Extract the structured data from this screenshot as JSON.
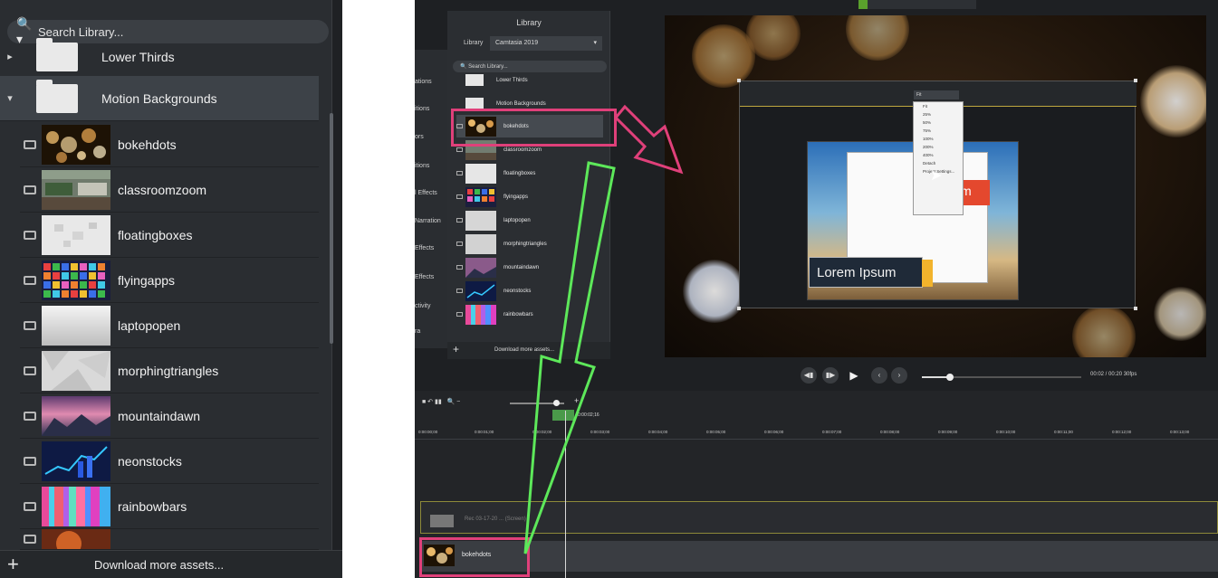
{
  "left_panel": {
    "search_placeholder": "Search Library...",
    "lower_thirds_label": "Lower Thirds",
    "motion_backgrounds_label": "Motion Backgrounds",
    "items": [
      "bokehdots",
      "classroomzoom",
      "floatingboxes",
      "flyingapps",
      "laptopopen",
      "morphingtriangles",
      "mountaindawn",
      "neonstocks",
      "rainbowbars"
    ],
    "download_label": "Download more assets..."
  },
  "app": {
    "library_title": "Library",
    "library_label": "Library",
    "library_value": "Camtasia 2019",
    "search_placeholder": "Search Library...",
    "lower_thirds": "Lower Thirds",
    "motion_backgrounds": "Motion Backgrounds",
    "items": [
      "bokehdots",
      "classroomzoom",
      "floatingboxes",
      "flyingapps",
      "laptopopen",
      "morphingtriangles",
      "mountaindawn",
      "neonstocks",
      "rainbowbars"
    ],
    "download_label": "Download more assets...",
    "sidebar_items": [
      "ations",
      "itions",
      "ors",
      "itions",
      "l Effects",
      "Narration",
      "Effects",
      "Effects",
      "ctivity",
      "ra"
    ],
    "zoom_value": "Fit",
    "zoom_options": [
      "Fit",
      "25%",
      "50%",
      "75%",
      "100%",
      "200%",
      "400%",
      "Detach",
      "Project Settings..."
    ],
    "lorem_text": "Lorem Ipsum",
    "red_tag_text": "m",
    "timecode": "00:02 / 00:20  30fps",
    "playhead_time": "0:00:02;16",
    "ruler_labels": [
      "0:00:00;00",
      "0:00:01;00",
      "0:00:02;00",
      "0:00:03;00",
      "0:00:04;00",
      "0:00:05;00",
      "0:00:06;00",
      "0:00:07;00",
      "0:00:08;00",
      "0:00:09;00",
      "0:00:10;00",
      "0:00:11;00",
      "0:00:12;00",
      "0:00:13;00"
    ],
    "track1_text": "Rec 03-17-20 ... (Screen)",
    "track2_label": "bokehdots"
  },
  "colors": {
    "highlight_pink": "#e0407a",
    "arrow_green": "#5de85a",
    "panel_bg": "#2a2d31"
  }
}
